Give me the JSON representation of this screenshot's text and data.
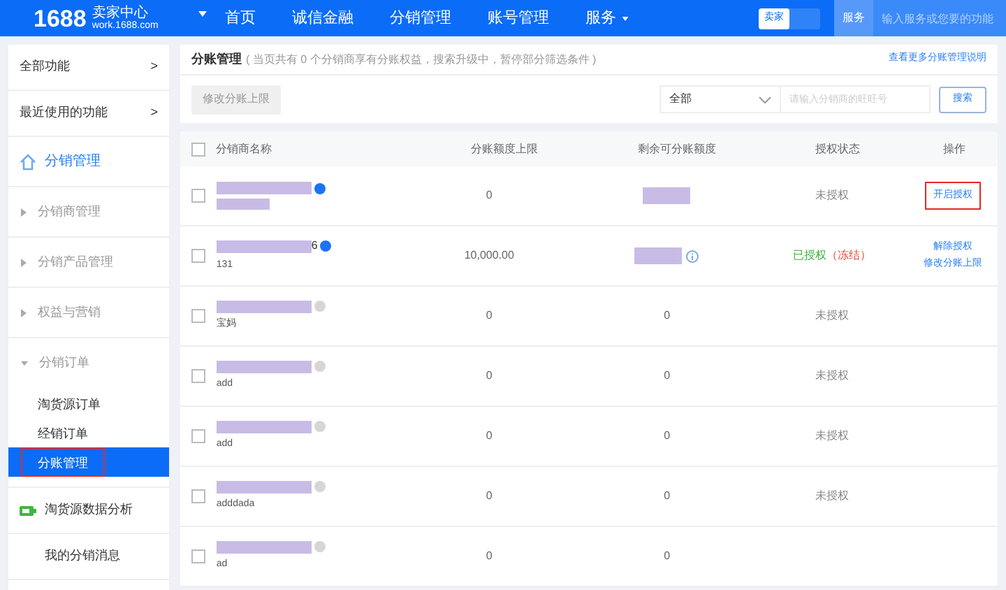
{
  "topbar": {
    "logo": "1688",
    "brand": "卖家中心",
    "domain": "work.1688.com",
    "nav": [
      {
        "label": "首页",
        "dropdown": false
      },
      {
        "label": "诚信金融",
        "dropdown": false
      },
      {
        "label": "分销管理",
        "dropdown": false
      },
      {
        "label": "账号管理",
        "dropdown": false
      },
      {
        "label": "服务",
        "dropdown": true
      }
    ],
    "role_toggle": [
      {
        "label": "卖家",
        "selected": true
      },
      {
        "selected": false
      }
    ],
    "search_scope": "服务",
    "search_placeholder": "输入服务或您要的功能"
  },
  "sidebar": {
    "items": [
      {
        "kind": "link",
        "label": "全部功能",
        "arrow": ">"
      },
      {
        "kind": "link",
        "label": "最近使用的功能",
        "arrow": ">"
      },
      {
        "kind": "section",
        "label": "分销管理"
      },
      {
        "kind": "group",
        "label": "分销商管理",
        "expanded": false
      },
      {
        "kind": "group",
        "label": "分销产品管理",
        "expanded": false
      },
      {
        "kind": "group",
        "label": "权益与营销",
        "expanded": false
      },
      {
        "kind": "group",
        "label": "分销订单",
        "expanded": true,
        "children": [
          {
            "label": "淘货源订单",
            "selected": false,
            "highlighted": false
          },
          {
            "label": "经销订单",
            "selected": false,
            "highlighted": false
          },
          {
            "label": "分账管理",
            "selected": true,
            "highlighted": true
          }
        ]
      },
      {
        "kind": "data",
        "label": "淘货源数据分析"
      },
      {
        "kind": "plain",
        "label": "我的分销消息"
      }
    ]
  },
  "main": {
    "title": "分账管理",
    "note": "( 当页共有 0 个分销商享有分账权益，搜索升级中，暂停部分筛选条件 )",
    "help_link": "查看更多分账管理说明",
    "batch_button": {
      "label": "修改分账上限",
      "disabled": true
    },
    "filter": {
      "value": "全部"
    },
    "search_placeholder": "请输入分销商的旺旺号",
    "search_button": "搜索",
    "table": {
      "select_all_checked": false,
      "columns": [
        "分销商名称",
        "分账额度上限",
        "剩余可分账额度",
        "授权状态",
        "操作"
      ],
      "rows": [
        {
          "checked": false,
          "name_suffix": "",
          "verified": true,
          "sub": "",
          "limit": "0",
          "remaining": "",
          "status": "未授权",
          "status_note": "",
          "actions": [
            {
              "label": "开启授权",
              "highlighted": true
            }
          ]
        },
        {
          "kind": "with_info",
          "checked": false,
          "name_suffix": "6",
          "verified": true,
          "sub": "131",
          "limit": "10,000.00",
          "remaining": "",
          "status": "已授权",
          "status_note": "（冻结）",
          "actions": [
            {
              "label": "解除授权",
              "highlighted": false
            },
            {
              "label": "修改分账上限",
              "highlighted": false
            }
          ]
        },
        {
          "checked": false,
          "name_suffix": "",
          "verified": false,
          "sub": "宝妈",
          "limit": "0",
          "remaining": "0",
          "status": "未授权",
          "status_note": "",
          "actions": []
        },
        {
          "checked": false,
          "name_suffix": "",
          "verified": false,
          "sub": "add",
          "limit": "0",
          "remaining": "0",
          "status": "未授权",
          "status_note": "",
          "actions": []
        },
        {
          "checked": false,
          "name_suffix": "",
          "verified": false,
          "sub": "add",
          "limit": "0",
          "remaining": "0",
          "status": "未授权",
          "status_note": "",
          "actions": []
        },
        {
          "checked": false,
          "name_suffix": "",
          "verified": false,
          "sub": "adddada",
          "limit": "0",
          "remaining": "0",
          "status": "未授权",
          "status_note": "",
          "actions": []
        },
        {
          "checked": false,
          "name_suffix": "",
          "verified": false,
          "sub": "ad",
          "limit": "0",
          "remaining": "0",
          "status": "",
          "status_note": "",
          "actions": []
        }
      ]
    }
  }
}
